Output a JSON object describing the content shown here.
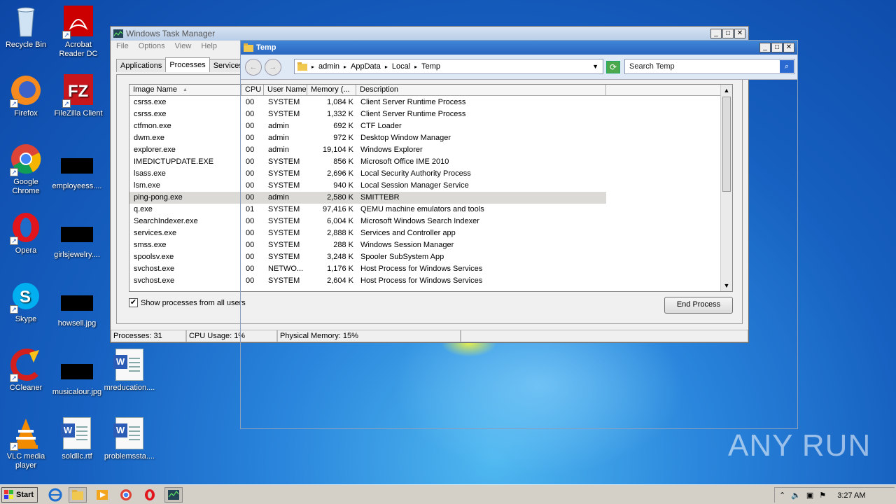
{
  "desktop_icons": [
    {
      "label": "Recycle Bin",
      "icon": "recycle-bin-icon"
    },
    {
      "label": "Acrobat Reader DC",
      "icon": "acrobat-icon"
    },
    {
      "label": "Firefox",
      "icon": "firefox-icon"
    },
    {
      "label": "FileZilla Client",
      "icon": "filezilla-icon"
    },
    {
      "label": "Google Chrome",
      "icon": "chrome-icon"
    },
    {
      "label": "employeess....",
      "icon": "image-file-icon"
    },
    {
      "label": "Opera",
      "icon": "opera-icon"
    },
    {
      "label": "girlsjewelry....",
      "icon": "image-file-icon"
    },
    {
      "label": "Skype",
      "icon": "skype-icon"
    },
    {
      "label": "howsell.jpg",
      "icon": "image-file-icon"
    },
    {
      "label": "CCleaner",
      "icon": "ccleaner-icon"
    },
    {
      "label": "musicalour.jpg",
      "icon": "image-file-icon"
    },
    {
      "label": "mreducation....",
      "icon": "word-doc-icon"
    },
    {
      "label": "VLC media player",
      "icon": "vlc-icon"
    },
    {
      "label": "soldllc.rtf",
      "icon": "word-doc-icon"
    },
    {
      "label": "problemssta....",
      "icon": "word-doc-icon"
    }
  ],
  "task_manager": {
    "title": "Windows Task Manager",
    "menu": [
      "File",
      "Options",
      "View",
      "Help"
    ],
    "tabs": [
      "Applications",
      "Processes",
      "Services"
    ],
    "columns": [
      "Image Name",
      "CPU",
      "User Name",
      "Memory (...",
      "Description"
    ],
    "processes": [
      {
        "name": "csrss.exe",
        "cpu": "00",
        "user": "SYSTEM",
        "mem": "1,084 K",
        "desc": "Client Server Runtime Process"
      },
      {
        "name": "csrss.exe",
        "cpu": "00",
        "user": "SYSTEM",
        "mem": "1,332 K",
        "desc": "Client Server Runtime Process"
      },
      {
        "name": "ctfmon.exe",
        "cpu": "00",
        "user": "admin",
        "mem": "692 K",
        "desc": "CTF Loader"
      },
      {
        "name": "dwm.exe",
        "cpu": "00",
        "user": "admin",
        "mem": "972 K",
        "desc": "Desktop Window Manager"
      },
      {
        "name": "explorer.exe",
        "cpu": "00",
        "user": "admin",
        "mem": "19,104 K",
        "desc": "Windows Explorer"
      },
      {
        "name": "IMEDICTUPDATE.EXE",
        "cpu": "00",
        "user": "SYSTEM",
        "mem": "856 K",
        "desc": "Microsoft Office IME 2010"
      },
      {
        "name": "lsass.exe",
        "cpu": "00",
        "user": "SYSTEM",
        "mem": "2,696 K",
        "desc": "Local Security Authority Process"
      },
      {
        "name": "lsm.exe",
        "cpu": "00",
        "user": "SYSTEM",
        "mem": "940 K",
        "desc": "Local Session Manager Service"
      },
      {
        "name": "ping-pong.exe",
        "cpu": "00",
        "user": "admin",
        "mem": "2,580 K",
        "desc": "SMITTEBR"
      },
      {
        "name": "q.exe",
        "cpu": "01",
        "user": "SYSTEM",
        "mem": "97,416 K",
        "desc": "QEMU machine emulators and tools"
      },
      {
        "name": "SearchIndexer.exe",
        "cpu": "00",
        "user": "SYSTEM",
        "mem": "6,004 K",
        "desc": "Microsoft Windows Search Indexer"
      },
      {
        "name": "services.exe",
        "cpu": "00",
        "user": "SYSTEM",
        "mem": "2,888 K",
        "desc": "Services and Controller app"
      },
      {
        "name": "smss.exe",
        "cpu": "00",
        "user": "SYSTEM",
        "mem": "288 K",
        "desc": "Windows Session Manager"
      },
      {
        "name": "spoolsv.exe",
        "cpu": "00",
        "user": "SYSTEM",
        "mem": "3,248 K",
        "desc": "Spooler SubSystem App"
      },
      {
        "name": "svchost.exe",
        "cpu": "00",
        "user": "NETWO...",
        "mem": "1,176 K",
        "desc": "Host Process for Windows Services"
      },
      {
        "name": "svchost.exe",
        "cpu": "00",
        "user": "SYSTEM",
        "mem": "2,604 K",
        "desc": "Host Process for Windows Services"
      }
    ],
    "show_all_label": "Show processes from all users",
    "end_process_label": "End Process",
    "status_processes": "Processes: 31",
    "status_cpu": "CPU Usage: 1%",
    "status_memory": "Physical Memory: 15%"
  },
  "explorer": {
    "title": "Temp",
    "breadcrumb": [
      "admin",
      "AppData",
      "Local",
      "Temp"
    ],
    "search_placeholder": "Search Temp"
  },
  "taskbar": {
    "start_label": "Start",
    "clock": "3:27 AM"
  },
  "watermark": "ANY RUN"
}
